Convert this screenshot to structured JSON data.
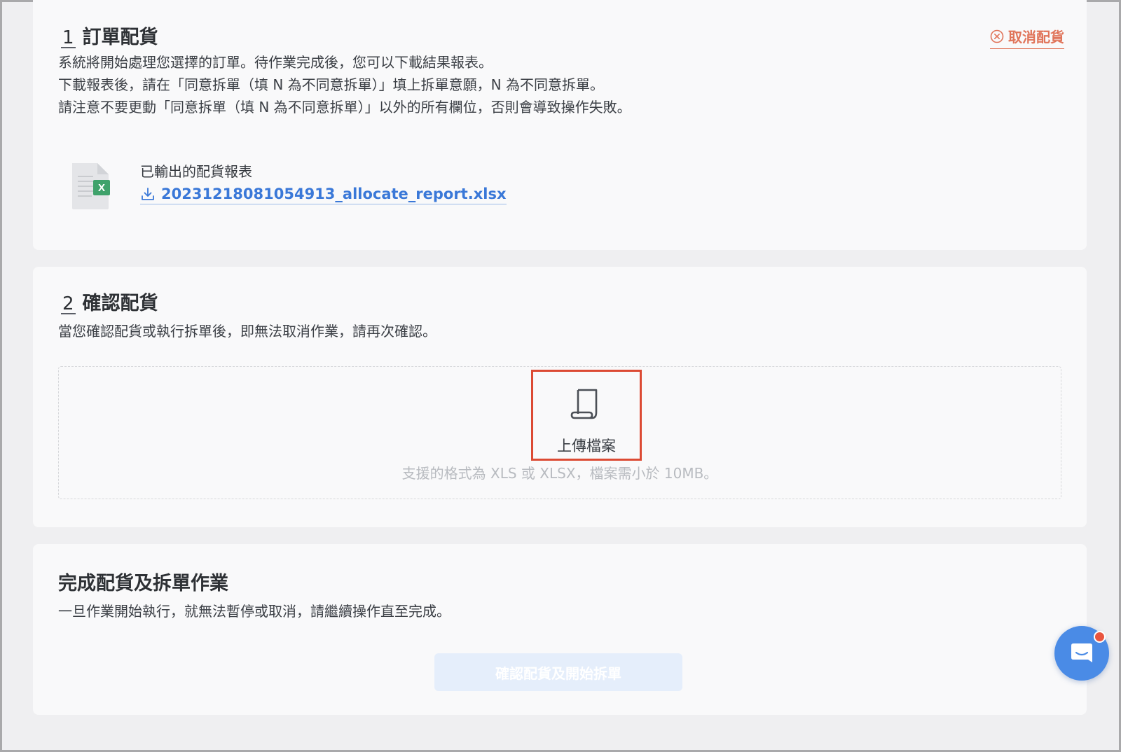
{
  "step1": {
    "number": "1",
    "title": "訂單配貨",
    "cancel_label": "取消配貨",
    "description": [
      "系統將開始處理您選擇的訂單。待作業完成後，您可以下載結果報表。",
      "下載報表後，請在「同意拆單（填 N 為不同意拆單）」填上拆單意願，N 為不同意拆單。",
      "請注意不要更動「同意拆單（填 N 為不同意拆單）」以外的所有欄位，否則會導致操作失敗。"
    ],
    "report_label": "已輸出的配貨報表",
    "report_filename": "20231218081054913_allocate_report.xlsx",
    "file_icon_badge": "X"
  },
  "step2": {
    "number": "2",
    "title": "確認配貨",
    "description": "當您確認配貨或執行拆單後，即無法取消作業，請再次確認。",
    "upload_label": "上傳檔案",
    "format_hint": "支援的格式為 XLS 或 XLSX，檔案需小於 10MB。"
  },
  "step3": {
    "title": "完成配貨及拆單作業",
    "description": "一旦作業開始執行，就無法暫停或取消，請繼續操作直至完成。",
    "confirm_button_label": "確認配貨及開始拆單"
  },
  "icons": {
    "cancel": "circle-x-icon",
    "download": "download-icon",
    "file": "excel-file-icon",
    "upload": "scroll-file-icon",
    "chat": "chat-bubble-icon"
  },
  "colors": {
    "link": "#3a78d8",
    "cancel": "#e0745a",
    "highlight_border": "#dc4a33",
    "chat_widget": "#4a8be6",
    "notification_dot": "#e9553f",
    "excel_green": "#3fa26b"
  }
}
